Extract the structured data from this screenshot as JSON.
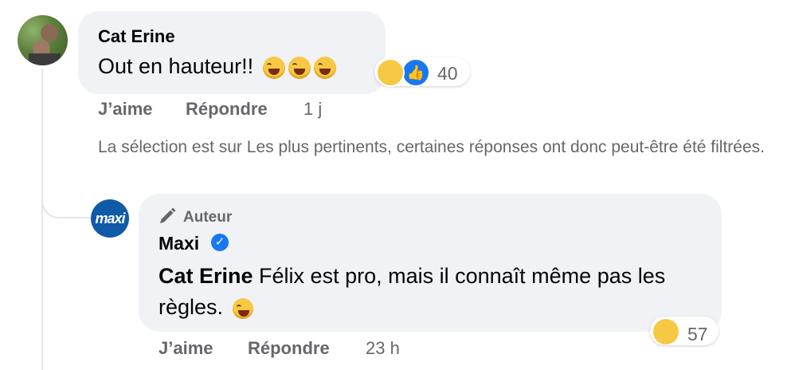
{
  "comment": {
    "author": "Cat Erine",
    "text": "Out en hauteur!!",
    "emojis": [
      "face-with-tears-of-joy-icon",
      "face-with-tears-of-joy-icon",
      "face-with-tears-of-joy-icon"
    ],
    "reaction_count": "40",
    "like_label": "J’aime",
    "reply_label": "Répondre",
    "time": "1 j"
  },
  "notice": "La sélection est sur Les plus pertinents, certaines réponses ont donc peut-être été filtrées.",
  "reply": {
    "badge": "Auteur",
    "author": "Maxi",
    "avatar_text": "maxi",
    "mention": "Cat Erine",
    "text": " Félix est pro, mais il connaît même pas les règles.",
    "reaction_count": "57",
    "like_label": "J’aime",
    "reply_label": "Répondre",
    "time": "23 h"
  },
  "colors": {
    "accent": "#1877f2",
    "muted": "#65676b",
    "bubble": "#f0f2f5",
    "brand_maxi": "#0f5ba8"
  }
}
